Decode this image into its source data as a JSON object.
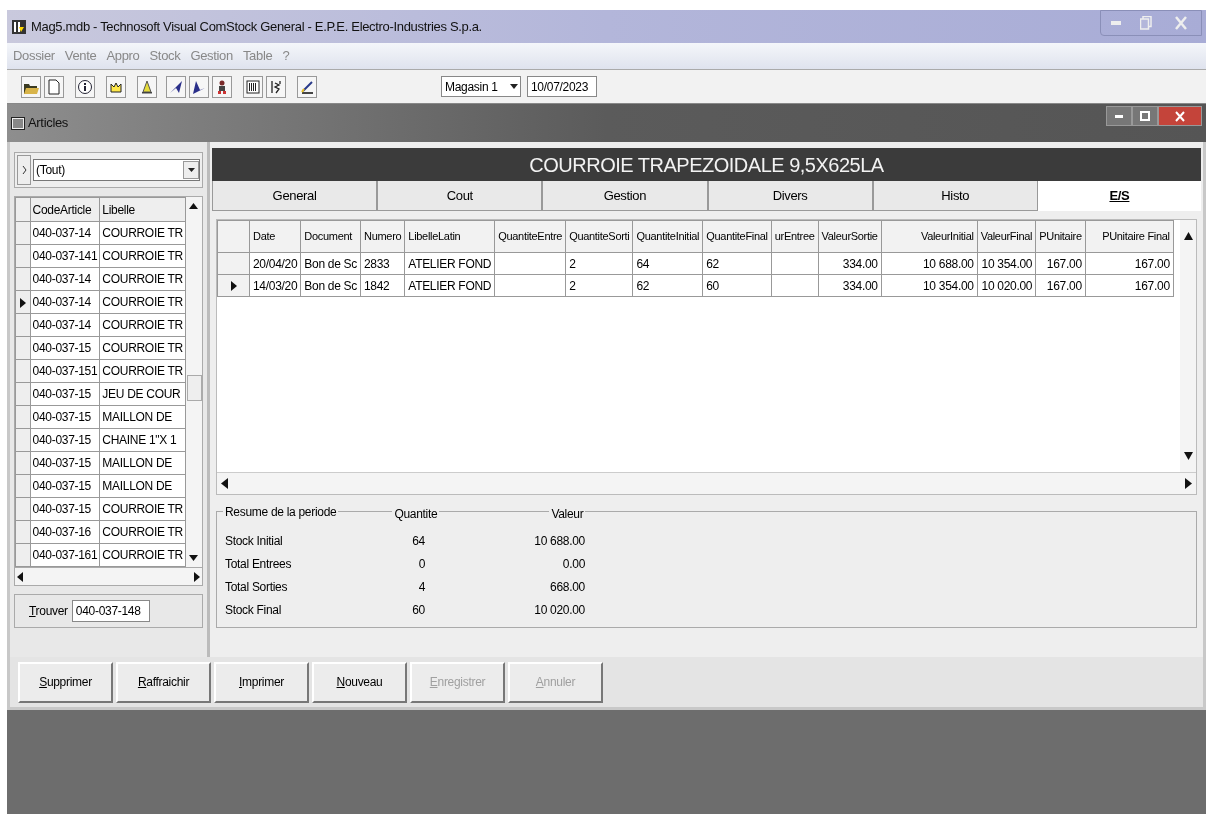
{
  "window": {
    "title": "Mag5.mdb - Technosoft Visual ComStock General - E.P.E. Electro-Industries  S.p.a."
  },
  "menu": [
    "Dossier",
    "Vente",
    "Appro",
    "Stock",
    "Gestion",
    "Table",
    "?"
  ],
  "toolbar": {
    "store": "Magasin 1",
    "date": "10/07/2023"
  },
  "child_window": {
    "title": "Articles"
  },
  "filter": {
    "value": "(Tout)"
  },
  "articles": {
    "columns": [
      "CodeArticle",
      "Libelle"
    ],
    "rows": [
      {
        "cells": [
          "040-037-14",
          "COURROIE TR"
        ],
        "selected": false
      },
      {
        "cells": [
          "040-037-141",
          "COURROIE TR"
        ],
        "selected": false
      },
      {
        "cells": [
          "040-037-14",
          "COURROIE TR"
        ],
        "selected": false
      },
      {
        "cells": [
          "040-037-14",
          "COURROIE TR"
        ],
        "selected": true
      },
      {
        "cells": [
          "040-037-14",
          "COURROIE TR"
        ],
        "selected": false
      },
      {
        "cells": [
          "040-037-15",
          "COURROIE TR"
        ],
        "selected": false
      },
      {
        "cells": [
          "040-037-151",
          "COURROIE TR"
        ],
        "selected": false
      },
      {
        "cells": [
          "040-037-15",
          "JEU DE COUR"
        ],
        "selected": false
      },
      {
        "cells": [
          "040-037-15",
          "MAILLON DE"
        ],
        "selected": false
      },
      {
        "cells": [
          "040-037-15",
          "CHAINE 1\"X 1"
        ],
        "selected": false
      },
      {
        "cells": [
          "040-037-15",
          "MAILLON DE"
        ],
        "selected": false
      },
      {
        "cells": [
          "040-037-15",
          "MAILLON DE"
        ],
        "selected": false
      },
      {
        "cells": [
          "040-037-15",
          "COURROIE TR"
        ],
        "selected": false
      },
      {
        "cells": [
          "040-037-16",
          "COURROIE TR"
        ],
        "selected": false
      },
      {
        "cells": [
          "040-037-161",
          "COURROIE TR"
        ],
        "selected": false
      }
    ]
  },
  "find": {
    "label": "Trouver",
    "value": "040-037-148"
  },
  "header": "COURROIE TRAPEZOIDALE 9,5X625LA",
  "tabs": [
    {
      "label": "General",
      "selected": false
    },
    {
      "label": "Cout",
      "selected": false
    },
    {
      "label": "Gestion",
      "selected": false
    },
    {
      "label": "Divers",
      "selected": false
    },
    {
      "label": "Histo",
      "selected": false
    },
    {
      "label": "E/S",
      "selected": true
    }
  ],
  "movements": {
    "columns": [
      "Date",
      "Document",
      "Numero",
      "LibelleLatin",
      "QuantiteEntre",
      "QuantiteSorti",
      "QuantiteInitial",
      "QuantiteFinal",
      "urEntree",
      "ValeurSortie",
      "ValeurInitial",
      "ValeurFinal",
      "PUnitaire",
      "PUnitaire Final"
    ],
    "rows": [
      {
        "cells": [
          "20/04/20",
          "Bon de Sc",
          "2833",
          "ATELIER FOND",
          null,
          "2",
          "64",
          "62",
          null,
          "334.00",
          "10 688.00",
          "10 354.00",
          "167.00",
          "167.00"
        ],
        "selected": false
      },
      {
        "cells": [
          "14/03/20",
          "Bon de Sc",
          "1842",
          "ATELIER FOND",
          null,
          "2",
          "62",
          "60",
          null,
          "334.00",
          "10 354.00",
          "10 020.00",
          "167.00",
          "167.00"
        ],
        "selected": true
      }
    ]
  },
  "summary": {
    "title": "Resume de la periode",
    "columns": [
      "Quantite",
      "Valeur"
    ],
    "rows": [
      {
        "label": "Stock Initial",
        "quantite": "64",
        "valeur": "10 688.00"
      },
      {
        "label": "Total Entrees",
        "quantite": "0",
        "valeur": "0.00"
      },
      {
        "label": "Total Sorties",
        "quantite": "4",
        "valeur": "668.00"
      },
      {
        "label": "Stock Final",
        "quantite": "60",
        "valeur": "10 020.00"
      }
    ]
  },
  "buttons": [
    {
      "label": "Supprimer",
      "disabled": false
    },
    {
      "label": "Raffraichir",
      "disabled": false
    },
    {
      "label": "Imprimer",
      "disabled": false
    },
    {
      "label": "Nouveau",
      "disabled": false
    },
    {
      "label": "Enregistrer",
      "disabled": true
    },
    {
      "label": "Annuler",
      "disabled": true
    }
  ]
}
